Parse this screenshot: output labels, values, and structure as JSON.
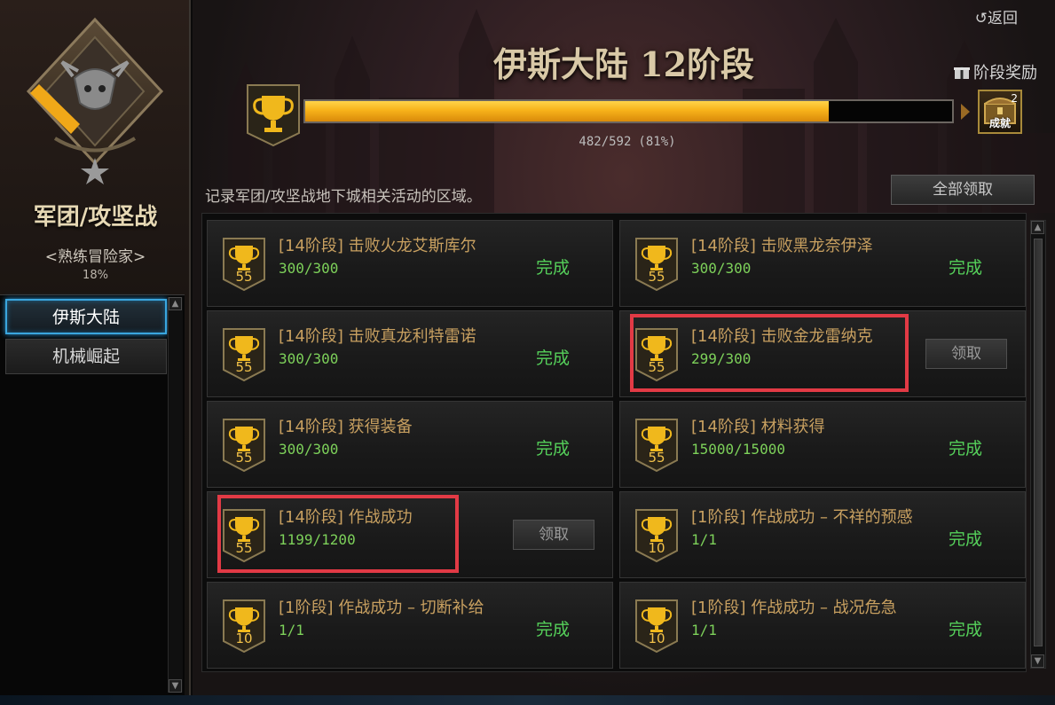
{
  "left_panel": {
    "title": "军团/攻坚战",
    "subtitle": "<熟练冒险家>",
    "percent": "18%",
    "nav_items": [
      {
        "label": "伊斯大陆",
        "active": true
      },
      {
        "label": "机械崛起",
        "active": false
      }
    ]
  },
  "header": {
    "back_label": "返回",
    "title": "伊斯大陆 12阶段",
    "stage_reward_label": "阶段奖励",
    "reward_chest_count": "2",
    "reward_chest_label": "成就",
    "progress_current": 482,
    "progress_max": 592,
    "progress_text": "482/592",
    "progress_percent_text": "(81%)",
    "progress_fraction": 0.81
  },
  "description": "记录军团/攻坚战地下城相关活动的区域。",
  "claim_all_label": "全部领取",
  "colors": {
    "progress_gold": "#f7b21a",
    "complete_green": "#55d05a",
    "highlight_red": "#e23a45",
    "active_blue": "#3aa6de"
  },
  "achievements": [
    {
      "level": "55",
      "name": "[14阶段] 击败火龙艾斯库尔",
      "progress": "300/300",
      "status": "完成",
      "claimable": false,
      "highlighted": false
    },
    {
      "level": "55",
      "name": "[14阶段] 击败黑龙奈伊泽",
      "progress": "300/300",
      "status": "完成",
      "claimable": false,
      "highlighted": false
    },
    {
      "level": "55",
      "name": "[14阶段] 击败真龙利特雷诺",
      "progress": "300/300",
      "status": "完成",
      "claimable": false,
      "highlighted": false
    },
    {
      "level": "55",
      "name": "[14阶段] 击败金龙雷纳克",
      "progress": "299/300",
      "status": "领取",
      "claimable": true,
      "highlighted": true
    },
    {
      "level": "55",
      "name": "[14阶段] 获得装备",
      "progress": "300/300",
      "status": "完成",
      "claimable": false,
      "highlighted": false
    },
    {
      "level": "55",
      "name": "[14阶段] 材料获得",
      "progress": "15000/15000",
      "status": "完成",
      "claimable": false,
      "highlighted": false
    },
    {
      "level": "55",
      "name": "[14阶段] 作战成功",
      "progress": "1199/1200",
      "status": "领取",
      "claimable": true,
      "highlighted": true
    },
    {
      "level": "10",
      "name": "[1阶段] 作战成功 – 不祥的预感",
      "progress": "1/1",
      "status": "完成",
      "claimable": false,
      "highlighted": false
    },
    {
      "level": "10",
      "name": "[1阶段] 作战成功 – 切断补给",
      "progress": "1/1",
      "status": "完成",
      "claimable": false,
      "highlighted": false
    },
    {
      "level": "10",
      "name": "[1阶段] 作战成功 – 战况危急",
      "progress": "1/1",
      "status": "完成",
      "claimable": false,
      "highlighted": false
    }
  ]
}
